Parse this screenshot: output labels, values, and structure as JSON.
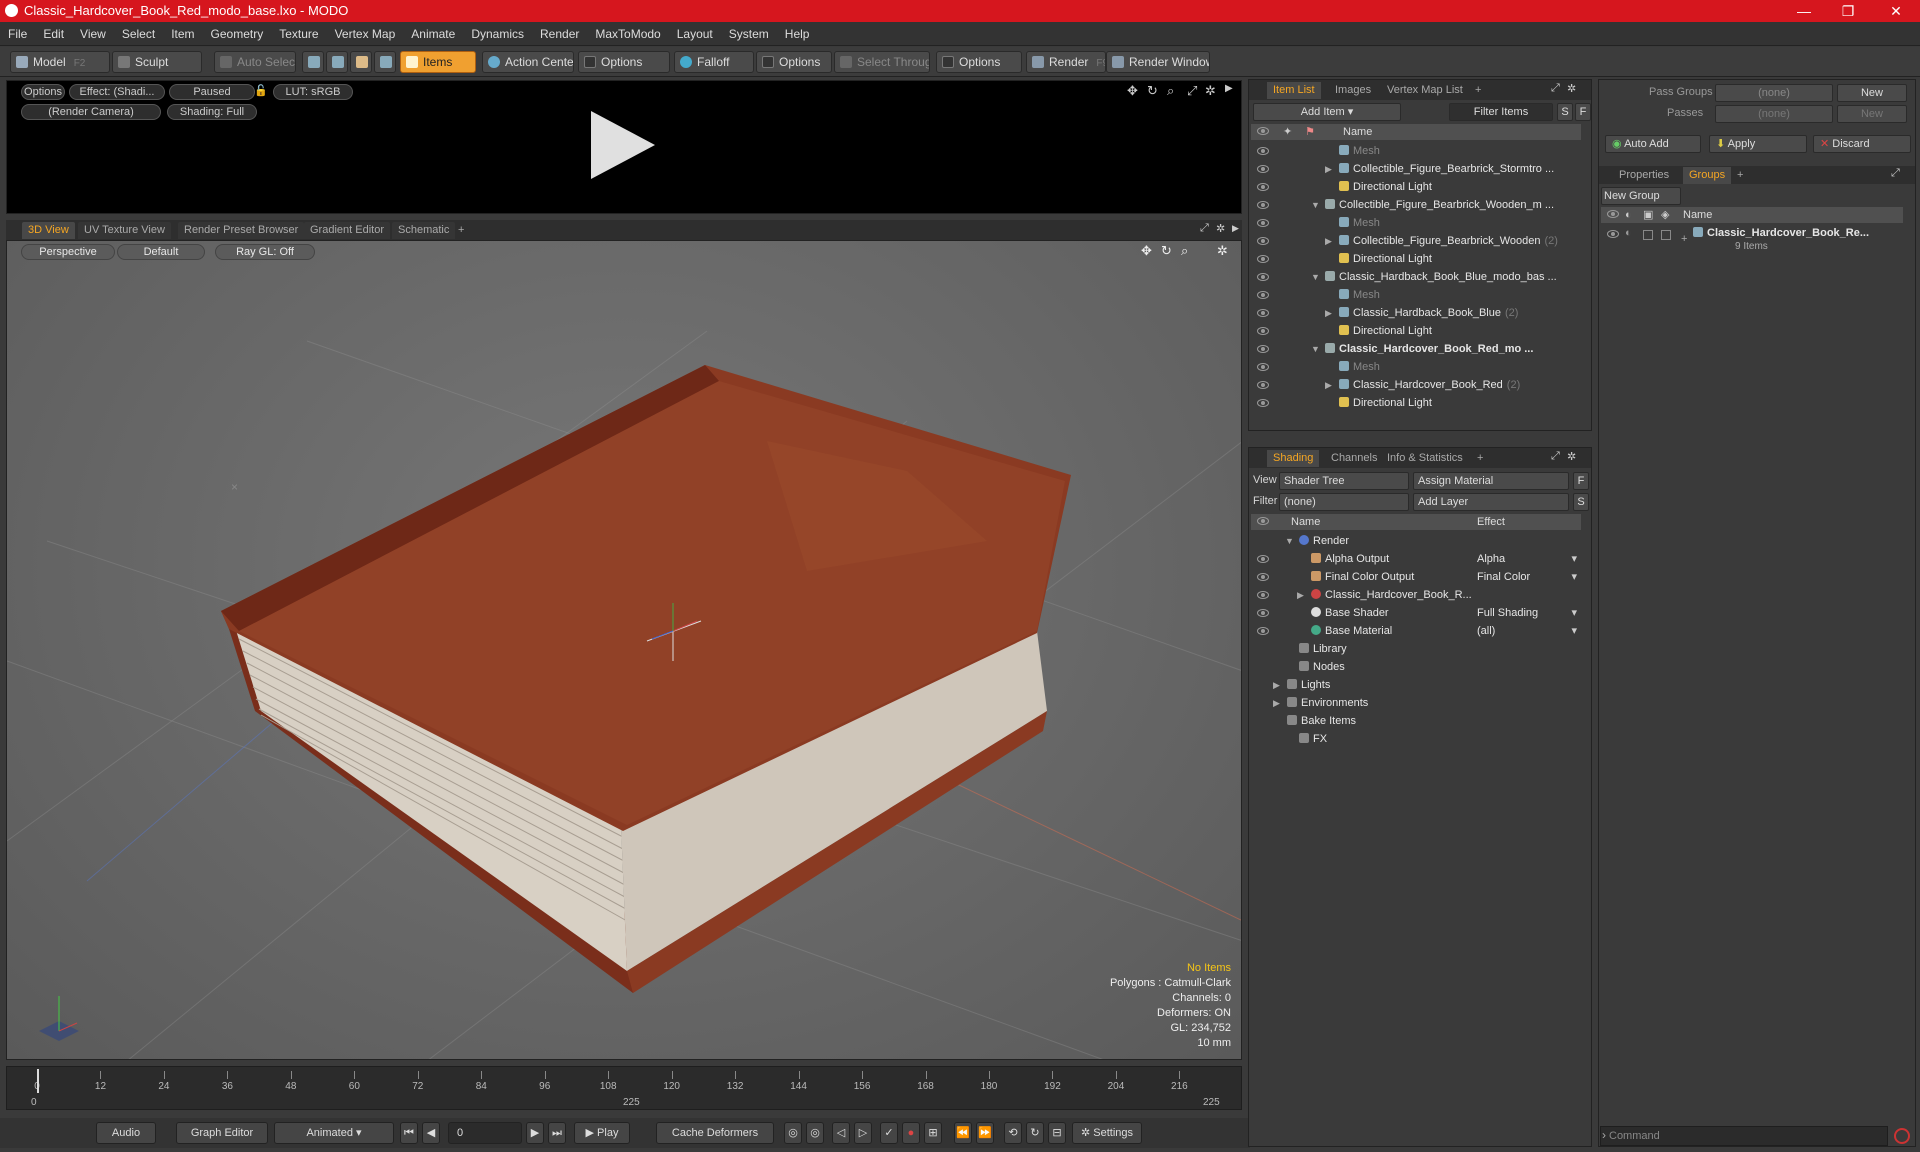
{
  "window": {
    "title": "Classic_Hardcover_Book_Red_modo_base.lxo - MODO",
    "minimize": "—",
    "maximize": "❐",
    "close": "✕"
  },
  "menu": [
    "File",
    "Edit",
    "View",
    "Select",
    "Item",
    "Geometry",
    "Texture",
    "Vertex Map",
    "Animate",
    "Dynamics",
    "Render",
    "MaxToModo",
    "Layout",
    "System",
    "Help"
  ],
  "toolbar": {
    "model": "Model",
    "model_key": "F2",
    "sculpt": "Sculpt",
    "auto_select": "Auto Select",
    "items": "Items",
    "action_center": "Action Center",
    "options1": "Options",
    "falloff": "Falloff",
    "options2": "Options",
    "select_through": "Select Through",
    "options3": "Options",
    "render": "Render",
    "render_key": "F9",
    "render_window": "Render Window"
  },
  "preview": {
    "options": "Options",
    "effect": "Effect: (Shadi...",
    "paused": "Paused",
    "lut": "LUT: sRGB",
    "camera": "(Render Camera)",
    "shading": "Shading: Full"
  },
  "view_tabs": [
    "3D View",
    "UV Texture View",
    "Render Preset Browser",
    "Gradient Editor",
    "Schematic",
    "+"
  ],
  "viewport": {
    "perspective": "Perspective",
    "default": "Default",
    "raygl": "Ray GL: Off"
  },
  "stats": {
    "no_items": "No Items",
    "polygons": "Polygons : Catmull-Clark",
    "channels": "Channels: 0",
    "deformers": "Deformers: ON",
    "gl": "GL: 234,752",
    "unit": "10 mm"
  },
  "timeline": {
    "ticks": [
      "0",
      "12",
      "24",
      "36",
      "48",
      "60",
      "72",
      "84",
      "96",
      "108",
      "120",
      "132",
      "144",
      "156",
      "168",
      "180",
      "192",
      "204",
      "216"
    ],
    "start": "0",
    "mid": "225",
    "end": "225"
  },
  "playbar": {
    "audio": "Audio",
    "graph_editor": "Graph Editor",
    "animated": "Animated",
    "frame": "0",
    "play": "Play",
    "cache_deformers": "Cache Deformers",
    "settings": "Settings"
  },
  "item_list": {
    "tabs": [
      "Item List",
      "Images",
      "Vertex Map List",
      "+"
    ],
    "add_item": "Add Item",
    "filter_items": "Filter Items",
    "s": "S",
    "f": "F",
    "name_header": "Name",
    "rows": [
      {
        "label": "Mesh",
        "count": "",
        "indent": 3,
        "dim": true,
        "bold": false,
        "arrow": ""
      },
      {
        "label": "Collectible_Figure_Bearbrick_Stormtro ...",
        "count": "",
        "indent": 3,
        "dim": false,
        "bold": false,
        "arrow": "▶"
      },
      {
        "label": "Directional Light",
        "count": "",
        "indent": 3,
        "dim": false,
        "bold": false,
        "arrow": ""
      },
      {
        "label": "Collectible_Figure_Bearbrick_Wooden_m ...",
        "count": "",
        "indent": 2,
        "dim": false,
        "bold": false,
        "arrow": "▼"
      },
      {
        "label": "Mesh",
        "count": "",
        "indent": 3,
        "dim": true,
        "bold": false,
        "arrow": ""
      },
      {
        "label": "Collectible_Figure_Bearbrick_Wooden",
        "count": "(2)",
        "indent": 3,
        "dim": false,
        "bold": false,
        "arrow": "▶"
      },
      {
        "label": "Directional Light",
        "count": "",
        "indent": 3,
        "dim": false,
        "bold": false,
        "arrow": ""
      },
      {
        "label": "Classic_Hardback_Book_Blue_modo_bas ...",
        "count": "",
        "indent": 2,
        "dim": false,
        "bold": false,
        "arrow": "▼"
      },
      {
        "label": "Mesh",
        "count": "",
        "indent": 3,
        "dim": true,
        "bold": false,
        "arrow": ""
      },
      {
        "label": "Classic_Hardback_Book_Blue",
        "count": "(2)",
        "indent": 3,
        "dim": false,
        "bold": false,
        "arrow": "▶"
      },
      {
        "label": "Directional Light",
        "count": "",
        "indent": 3,
        "dim": false,
        "bold": false,
        "arrow": ""
      },
      {
        "label": "Classic_Hardcover_Book_Red_mo ...",
        "count": "",
        "indent": 2,
        "dim": false,
        "bold": true,
        "arrow": "▼"
      },
      {
        "label": "Mesh",
        "count": "",
        "indent": 3,
        "dim": true,
        "bold": false,
        "arrow": ""
      },
      {
        "label": "Classic_Hardcover_Book_Red",
        "count": "(2)",
        "indent": 3,
        "dim": false,
        "bold": false,
        "arrow": "▶"
      },
      {
        "label": "Directional Light",
        "count": "",
        "indent": 3,
        "dim": false,
        "bold": false,
        "arrow": ""
      }
    ]
  },
  "shading": {
    "tabs": [
      "Shading",
      "Channels",
      "Info & Statistics",
      "+"
    ],
    "view_label": "View",
    "view_value": "Shader Tree",
    "assign_material": "Assign Material",
    "filter_label": "Filter",
    "filter_value": "(none)",
    "add_layer": "Add Layer",
    "f": "F",
    "s": "S",
    "name_header": "Name",
    "effect_header": "Effect",
    "rows": [
      {
        "label": "Render",
        "effect": "",
        "indent": 1,
        "arrow": "▼",
        "eye": false
      },
      {
        "label": "Alpha Output",
        "effect": "Alpha",
        "indent": 2,
        "arrow": "",
        "eye": true
      },
      {
        "label": "Final Color Output",
        "effect": "Final Color",
        "indent": 2,
        "arrow": "",
        "eye": true
      },
      {
        "label": "Classic_Hardcover_Book_R...",
        "effect": "",
        "indent": 2,
        "arrow": "▶",
        "eye": true
      },
      {
        "label": "Base Shader",
        "effect": "Full Shading",
        "indent": 2,
        "arrow": "",
        "eye": true
      },
      {
        "label": "Base Material",
        "effect": "(all)",
        "indent": 2,
        "arrow": "",
        "eye": true
      },
      {
        "label": "Library",
        "effect": "",
        "indent": 1,
        "arrow": "",
        "eye": false
      },
      {
        "label": "Nodes",
        "effect": "",
        "indent": 1,
        "arrow": "",
        "eye": false
      },
      {
        "label": "Lights",
        "effect": "",
        "indent": 0,
        "arrow": "▶",
        "eye": false
      },
      {
        "label": "Environments",
        "effect": "",
        "indent": 0,
        "arrow": "▶",
        "eye": false
      },
      {
        "label": "Bake Items",
        "effect": "",
        "indent": 0,
        "arrow": "",
        "eye": false
      },
      {
        "label": "FX",
        "effect": "",
        "indent": 1,
        "arrow": "",
        "eye": false
      }
    ]
  },
  "groups": {
    "pass_groups": "Pass Groups",
    "pass_value": "(none)",
    "new": "New",
    "passes": "Passes",
    "passes_value": "(none)",
    "new2": "New",
    "auto_add": "Auto Add",
    "apply": "Apply",
    "discard": "Discard",
    "tabs": [
      "Properties",
      "Groups",
      "+"
    ],
    "new_group": "New Group",
    "name_header": "Name",
    "group_name": "Classic_Hardcover_Book_Re...",
    "group_count": "9 Items"
  },
  "command": {
    "placeholder": "Command"
  },
  "colors": {
    "accent": "#f5a623",
    "titlebar": "#d6161e",
    "book_cover": "#8a3a22"
  }
}
